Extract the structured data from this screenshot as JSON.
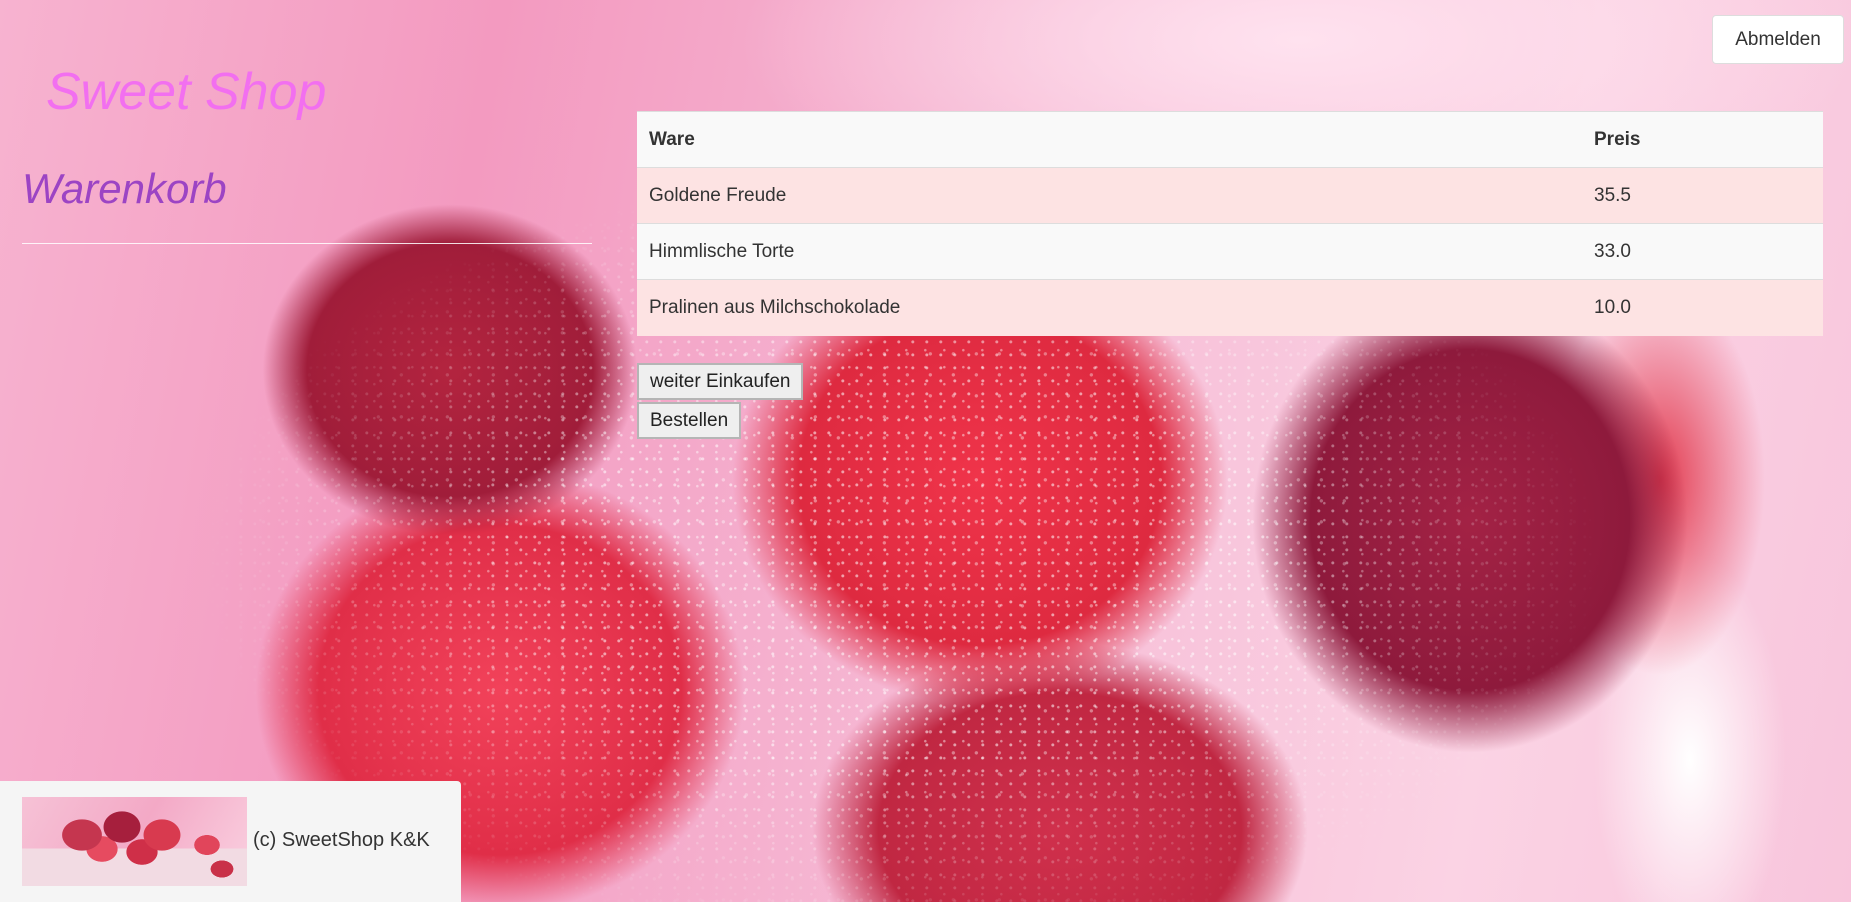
{
  "header": {
    "brand": "Sweet Shop",
    "logout_label": "Abmelden"
  },
  "page": {
    "title": "Warenkorb"
  },
  "cart": {
    "columns": [
      "Ware",
      "Preis"
    ],
    "rows": [
      {
        "ware": "Goldene Freude",
        "preis": "35.5"
      },
      {
        "ware": "Himmlische Torte",
        "preis": "33.0"
      },
      {
        "ware": "Pralinen aus Milchschokolade",
        "preis": "10.0"
      }
    ]
  },
  "actions": {
    "continue_label": "weiter Einkaufen",
    "order_label": "Bestellen"
  },
  "footer": {
    "copyright": "(c) SweetShop K&K"
  },
  "colors": {
    "brand": "#f26ff0",
    "title": "#9c44c4",
    "row_odd": "#fde3e3",
    "row_even": "#f9f9f9"
  }
}
